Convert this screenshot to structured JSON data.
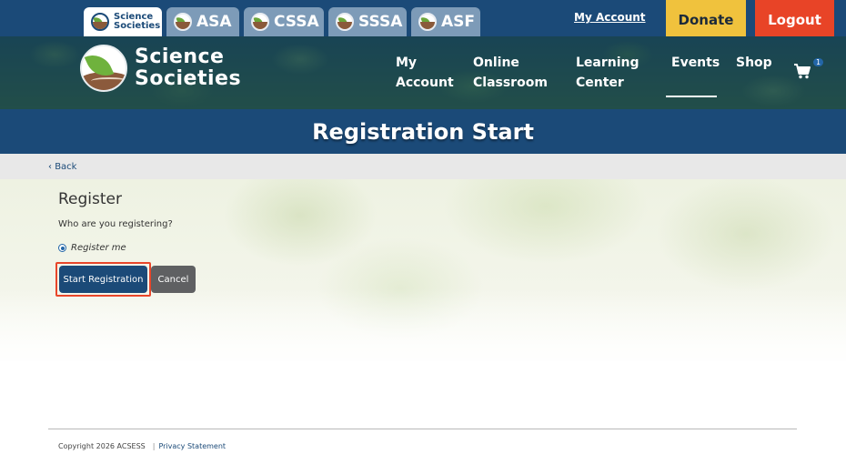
{
  "society_tabs": [
    {
      "label_line1": "Science",
      "label_line2": "Societies",
      "active": true
    },
    {
      "label": "ASA",
      "active": false
    },
    {
      "label": "CSSA",
      "active": false
    },
    {
      "label": "SSSA",
      "active": false
    },
    {
      "label": "ASF",
      "active": false
    }
  ],
  "utility": {
    "my_account": "My Account",
    "donate": "Donate",
    "logout": "Logout"
  },
  "brand": {
    "line1": "Science",
    "line2": "Societies"
  },
  "nav": {
    "my_account_line1": "My",
    "my_account_line2": "Account",
    "online_line1": "Online",
    "online_line2": "Classroom",
    "learning_line1": "Learning",
    "learning_line2": "Center",
    "events": "Events",
    "shop": "Shop",
    "cart_count": "1"
  },
  "page": {
    "title": "Registration Start",
    "back": "Back"
  },
  "form": {
    "heading": "Register",
    "question": "Who are you registering?",
    "option": "Register me",
    "option_selected": true,
    "start_button": "Start Registration",
    "cancel_button": "Cancel"
  },
  "footer": {
    "copyright": "Copyright 2026 ACSESS",
    "separator": "|",
    "privacy": "Privacy Statement"
  },
  "colors": {
    "navy": "#1b4a78",
    "donate": "#f0c23d",
    "logout": "#e84427",
    "highlight": "#e8462a"
  }
}
